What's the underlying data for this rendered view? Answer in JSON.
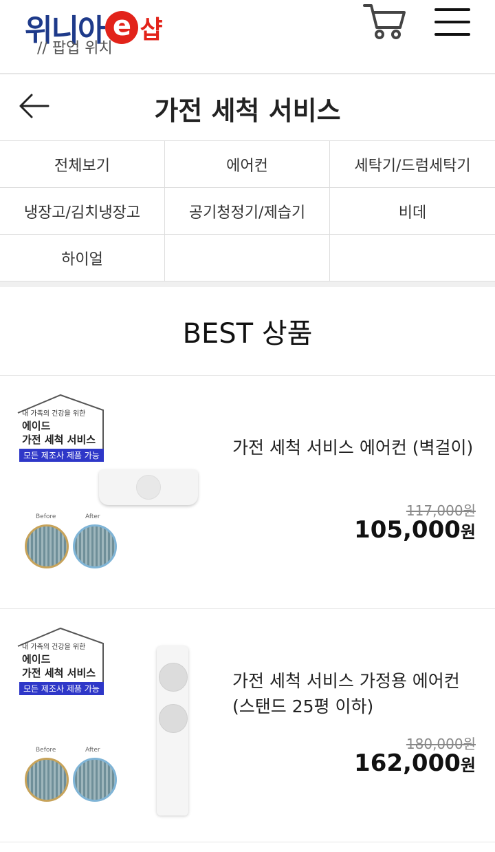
{
  "header": {
    "logo_main": "위니아",
    "logo_e": "e",
    "logo_shop": "샵",
    "popup_note": "// 팝업 위치",
    "cart_icon": "cart-icon",
    "menu_icon": "hamburger-menu-icon"
  },
  "titlebar": {
    "back_icon": "back-arrow-icon",
    "title": "가전 세척 서비스"
  },
  "categories": [
    "전체보기",
    "에어컨",
    "세탁기/드럼세탁기",
    "냉장고/김치냉장고",
    "공기청정기/제습기",
    "비데",
    "하이얼",
    "",
    ""
  ],
  "best_title": "BEST 상품",
  "products": [
    {
      "badge": {
        "line1": "내 가족의 건강을 위한",
        "line2": "에이드",
        "line3": "가전 세척 서비스",
        "tag": "모든 제조사 제품 가능",
        "before": "Before",
        "after": "After"
      },
      "name": "가전 세척 서비스 에어컨 (벽걸이)",
      "original_price": "117,000원",
      "price": "105,000",
      "currency": "원"
    },
    {
      "badge": {
        "line1": "내 가족의 건강을 위한",
        "line2": "에이드",
        "line3": "가전 세척 서비스",
        "tag": "모든 제조사 제품 가능",
        "before": "Before",
        "after": "After"
      },
      "name": "가전 세척 서비스 가정용 에어컨 (스탠드 25평 이하)",
      "original_price": "180,000원",
      "price": "162,000",
      "currency": "원"
    }
  ],
  "colors": {
    "brand_blue": "#1e3a8a",
    "brand_red": "#e2231a",
    "tag_blue": "#2e37c8"
  }
}
